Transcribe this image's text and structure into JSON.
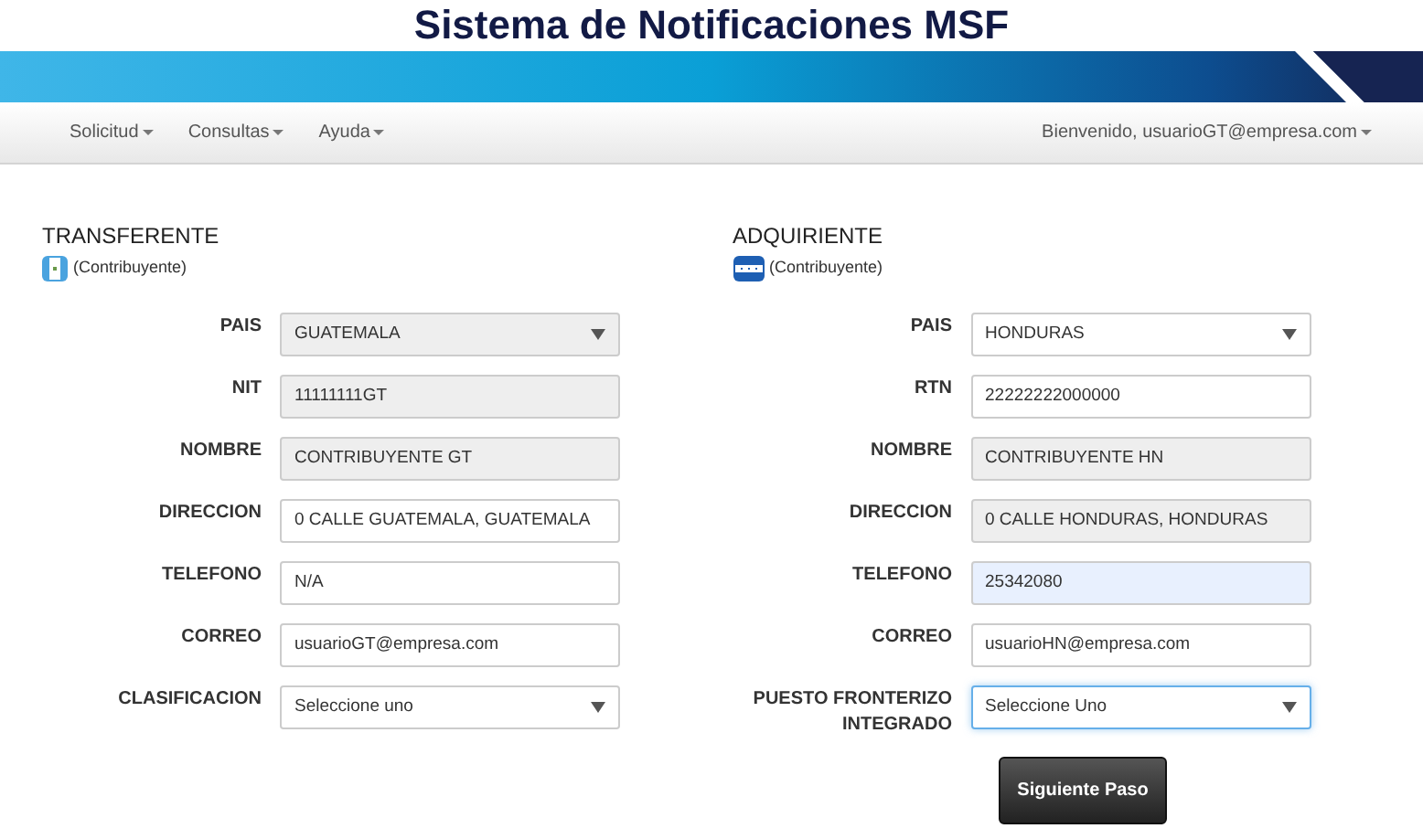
{
  "header": {
    "title": "Sistema de Notificaciones MSF"
  },
  "nav": {
    "menus": [
      "Solicitud",
      "Consultas",
      "Ayuda"
    ],
    "user_menu": "Bienvenido, usuarioGT@empresa.com"
  },
  "sections": [
    {
      "title": "TRANSFERENTE",
      "subtitle": "(Contribuyente)",
      "fields": [
        {
          "label": "PAIS",
          "kind": "select",
          "value": "GUATEMALA",
          "readonly": true,
          "autofilled": false,
          "focused": false
        },
        {
          "label": "NIT",
          "kind": "input",
          "value": "11111111GT",
          "readonly": true,
          "autofilled": false,
          "focused": false
        },
        {
          "label": "NOMBRE",
          "kind": "input",
          "value": "CONTRIBUYENTE GT",
          "readonly": true,
          "autofilled": false,
          "focused": false
        },
        {
          "label": "DIRECCION",
          "kind": "input",
          "value": "0 CALLE GUATEMALA, GUATEMALA",
          "readonly": false,
          "autofilled": false,
          "focused": false
        },
        {
          "label": "TELEFONO",
          "kind": "input",
          "value": "N/A",
          "readonly": false,
          "autofilled": false,
          "focused": false
        },
        {
          "label": "CORREO",
          "kind": "input",
          "value": "usuarioGT@empresa.com",
          "readonly": false,
          "autofilled": false,
          "focused": false
        },
        {
          "label": "CLASIFICACION",
          "kind": "select",
          "value": "Seleccione uno",
          "readonly": false,
          "autofilled": false,
          "focused": false
        }
      ]
    },
    {
      "title": "ADQUIRIENTE",
      "subtitle": "(Contribuyente)",
      "fields": [
        {
          "label": "PAIS",
          "kind": "select",
          "value": "HONDURAS",
          "readonly": false,
          "autofilled": false,
          "focused": false
        },
        {
          "label": "RTN",
          "kind": "input",
          "value": "22222222000000",
          "readonly": false,
          "autofilled": false,
          "focused": false
        },
        {
          "label": "NOMBRE",
          "kind": "input",
          "value": "CONTRIBUYENTE HN",
          "readonly": true,
          "autofilled": false,
          "focused": false
        },
        {
          "label": "DIRECCION",
          "kind": "input",
          "value": "0 CALLE HONDURAS, HONDURAS",
          "readonly": true,
          "autofilled": false,
          "focused": false
        },
        {
          "label": "TELEFONO",
          "kind": "input",
          "value": "25342080",
          "readonly": false,
          "autofilled": true,
          "focused": false
        },
        {
          "label": "CORREO",
          "kind": "input",
          "value": "usuarioHN@empresa.com",
          "readonly": false,
          "autofilled": false,
          "focused": false
        },
        {
          "label": "PUESTO FRONTERIZO INTEGRADO",
          "kind": "select",
          "value": "Seleccione Uno",
          "readonly": false,
          "autofilled": false,
          "focused": true
        }
      ]
    }
  ],
  "next_button": "Siguiente Paso"
}
